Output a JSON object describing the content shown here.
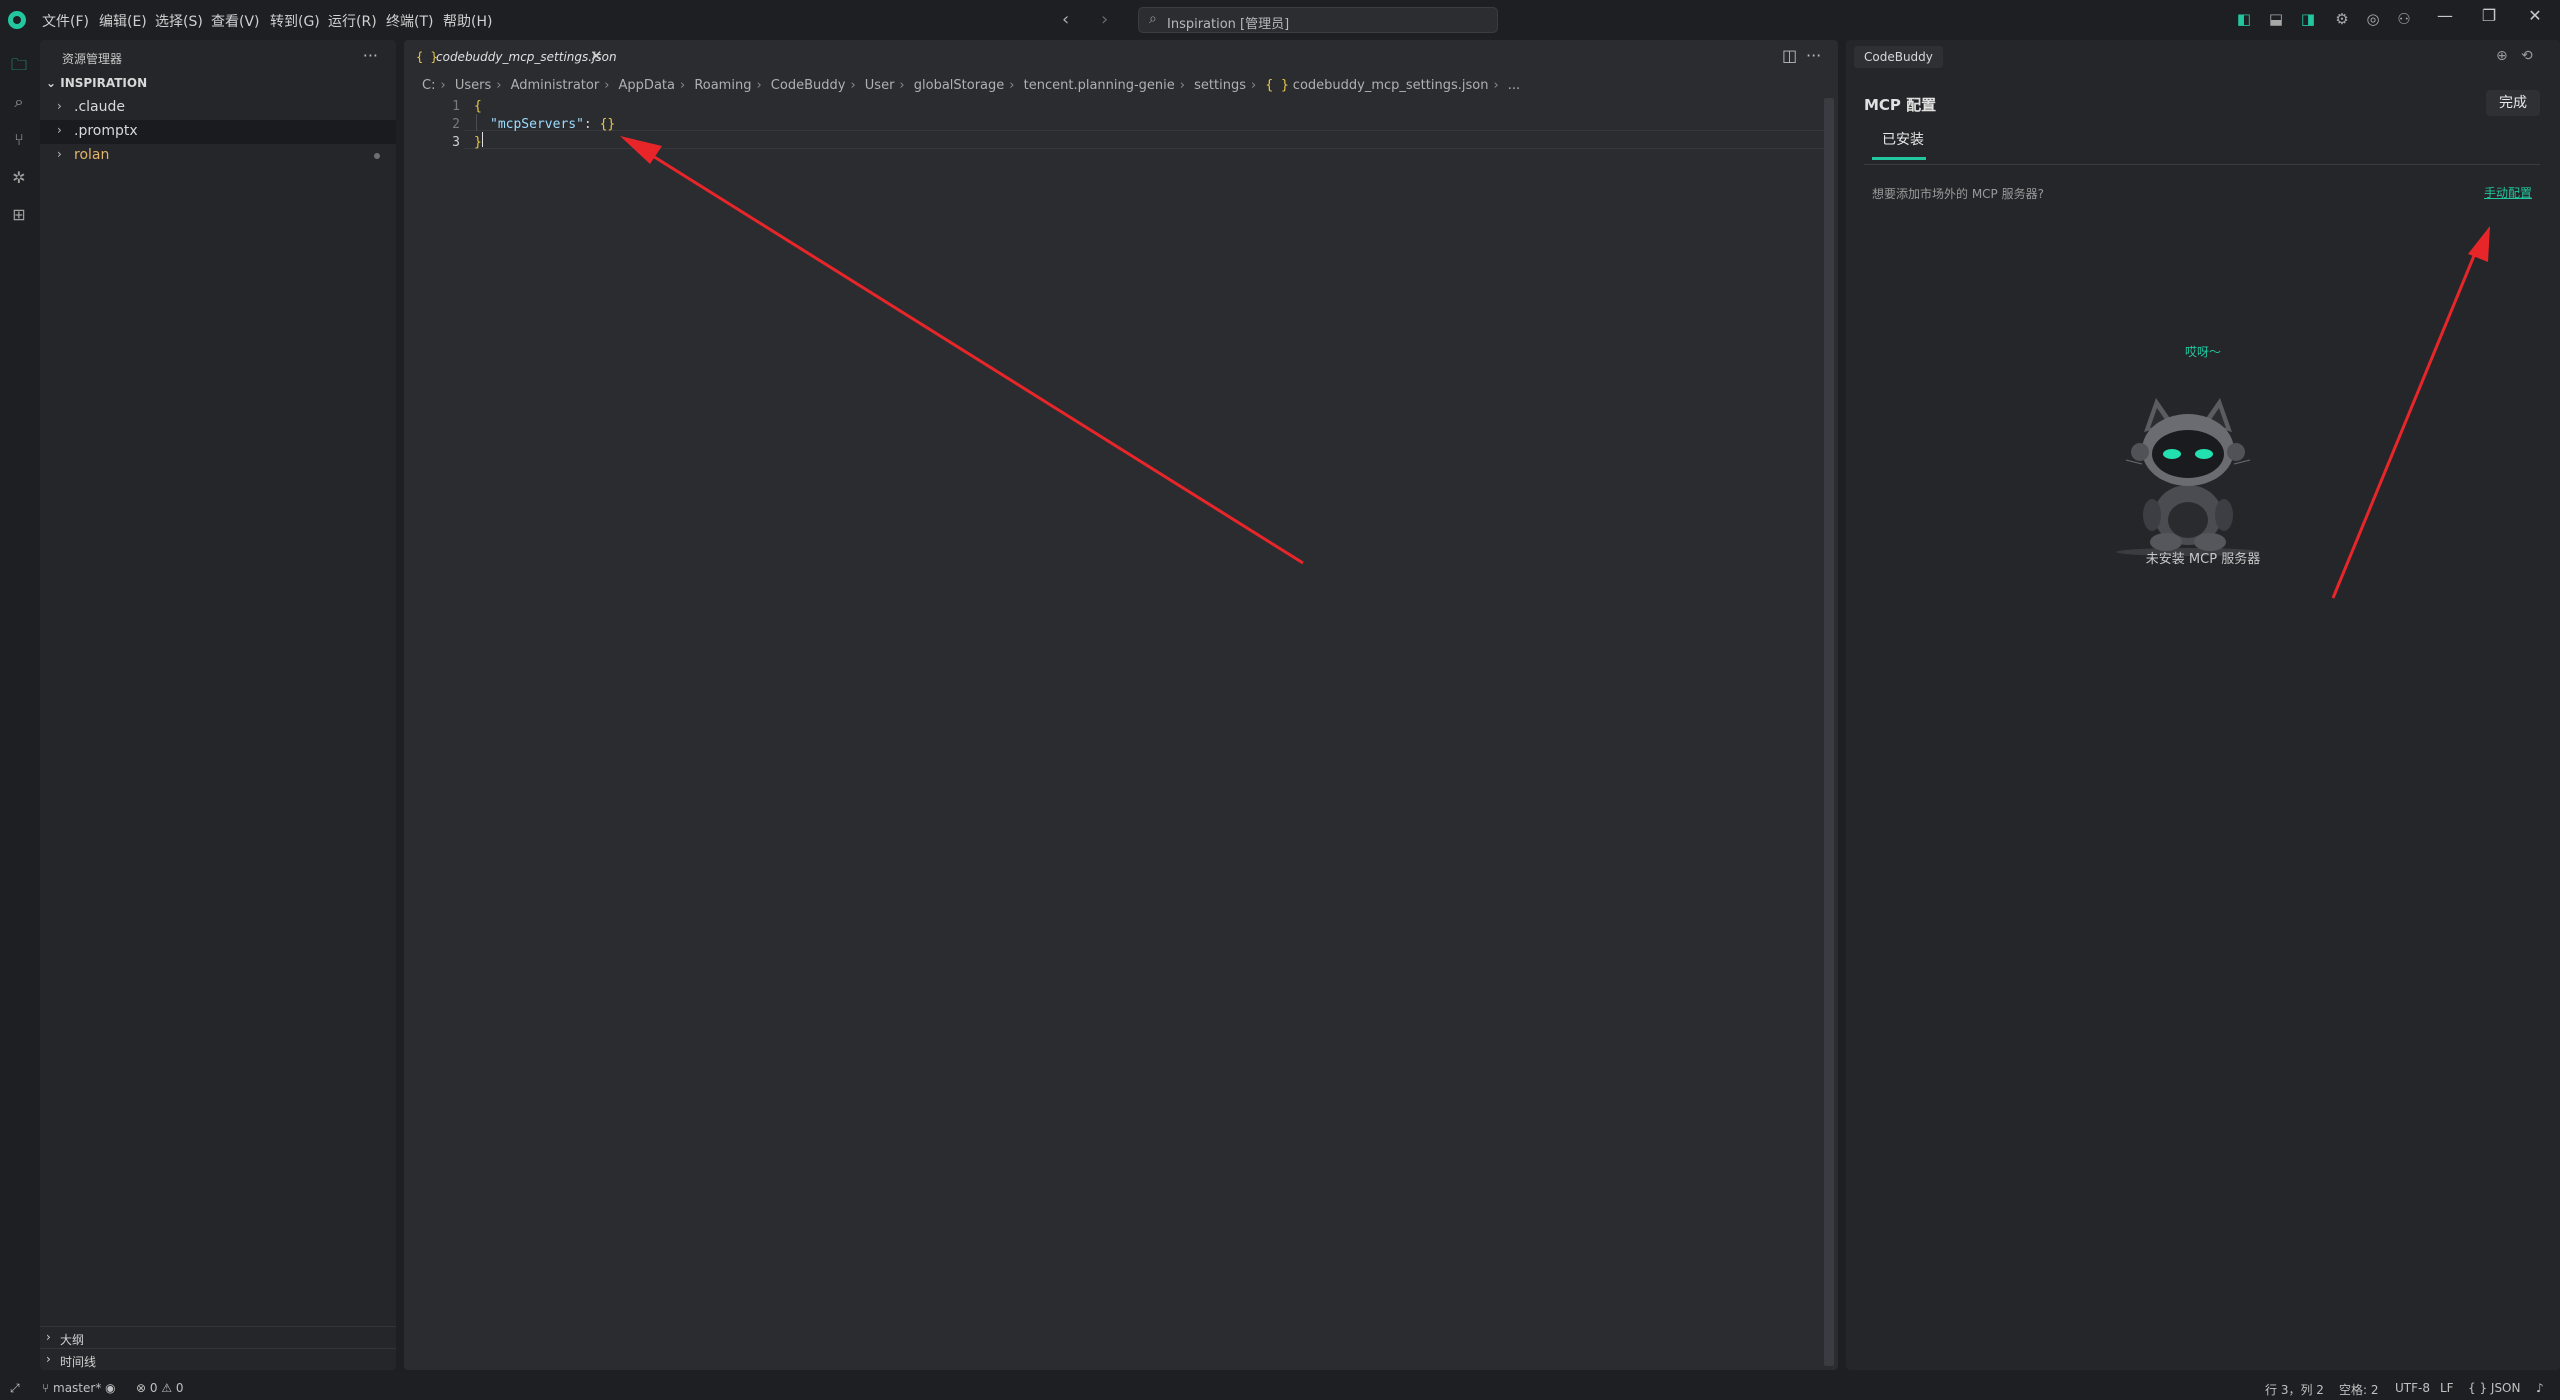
{
  "titlebar": {
    "menus": [
      "文件(F)",
      "编辑(E)",
      "选择(S)",
      "查看(V)",
      "转到(G)",
      "运行(R)",
      "终端(T)",
      "帮助(H)"
    ],
    "back_glyph": "‹",
    "forward_glyph": "›",
    "search_text": "Inspiration [管理员]",
    "win_minimize": "—",
    "win_restore": "❐",
    "win_close": "✕"
  },
  "sidebar": {
    "title": "资源管理器",
    "more": "···",
    "root": "INSPIRATION",
    "items": [
      {
        "label": ".claude",
        "color": "#d8d8d8"
      },
      {
        "label": ".promptx",
        "color": "#d8d8d8"
      },
      {
        "label": "rolan",
        "color": "#e2b36a"
      }
    ],
    "outline": "大纲",
    "timeline": "时间线"
  },
  "editor": {
    "tab_icon": "{ }",
    "tab_name": "codebuddy_mcp_settings.json",
    "tab_close": "✕",
    "breadcrumb": [
      "C:",
      "Users",
      "Administrator",
      "AppData",
      "Roaming",
      "CodeBuddy",
      "User",
      "globalStorage",
      "tencent.planning-genie",
      "settings"
    ],
    "breadcrumb_file": "codebuddy_mcp_settings.json",
    "breadcrumb_tail": "...",
    "lines": [
      "1",
      "2",
      "3"
    ],
    "code": {
      "line1": "{",
      "line2_key": "\"mcpServers\"",
      "line2_colon": ": ",
      "line2_value": "{}",
      "line3": "}"
    }
  },
  "panel": {
    "tab": "CodeBuddy",
    "title": "MCP 配置",
    "done": "完成",
    "installed_tab": "已安装",
    "hint": "想要添加市场外的 MCP 服务器?",
    "manual_link": "手动配置",
    "greet": "哎呀～",
    "empty": "未安装 MCP 服务器"
  },
  "statusbar": {
    "branch": "master*",
    "problems": "⊗ 0 ⚠ 0",
    "position": "行 3，列 2",
    "spaces": "空格: 2",
    "encoding": "UTF-8",
    "eol": "LF",
    "language": "{ } JSON"
  },
  "colors": {
    "accent": "#22c7a0",
    "arrow": "#e8262a"
  }
}
